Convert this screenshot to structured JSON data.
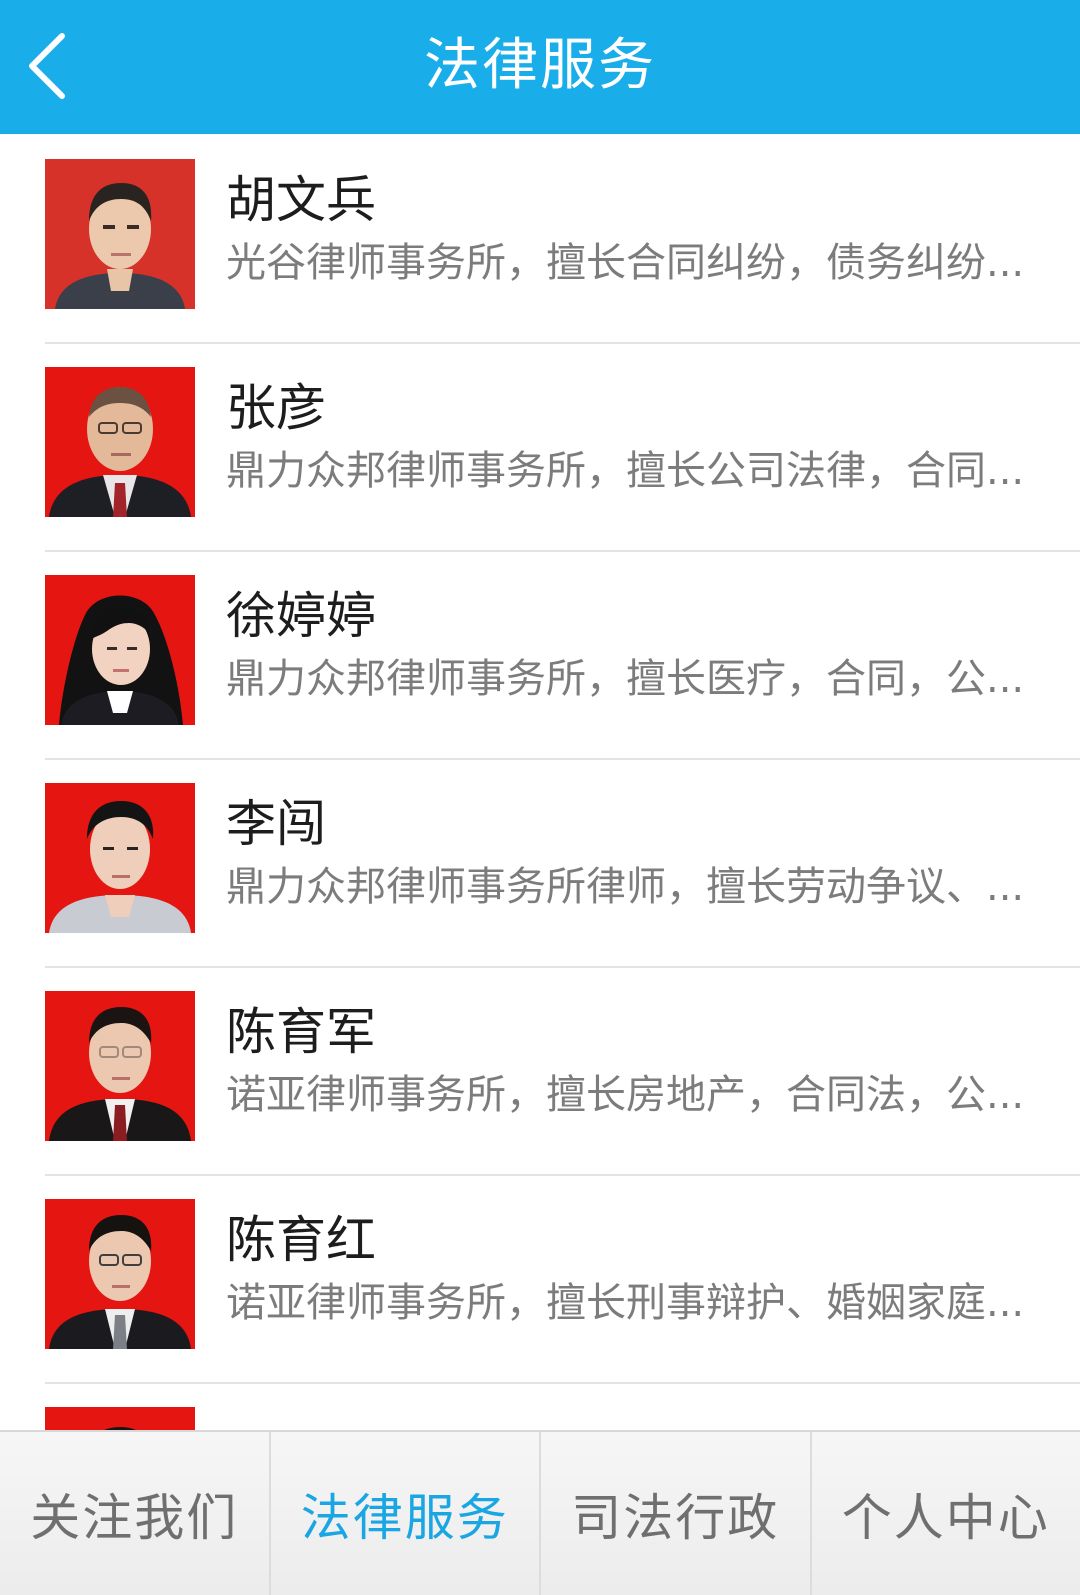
{
  "header": {
    "title": "法律服务",
    "back_icon": "chevron-left-icon",
    "background_color": "#19aeea"
  },
  "lawyers": [
    {
      "name": "胡文兵",
      "desc": "光谷律师事务所，擅长合同纠纷，债务纠纷..."
    },
    {
      "name": "张彦",
      "desc": "鼎力众邦律师事务所，擅长公司法律，合同..."
    },
    {
      "name": "徐婷婷",
      "desc": "鼎力众邦律师事务所，擅长医疗，合同，公..."
    },
    {
      "name": "李闯",
      "desc": "鼎力众邦律师事务所律师，擅长劳动争议、..."
    },
    {
      "name": "陈育军",
      "desc": "诺亚律师事务所，擅长房地产，合同法，公..."
    },
    {
      "name": "陈育红",
      "desc": "诺亚律师事务所，擅长刑事辩护、婚姻家庭..."
    }
  ],
  "tabs": [
    {
      "label": "关注我们"
    },
    {
      "label": "法律服务",
      "active": true
    },
    {
      "label": "司法行政"
    },
    {
      "label": "个人中心"
    }
  ],
  "colors": {
    "accent": "#1aa6e3",
    "avatar_background": "#e51512"
  }
}
